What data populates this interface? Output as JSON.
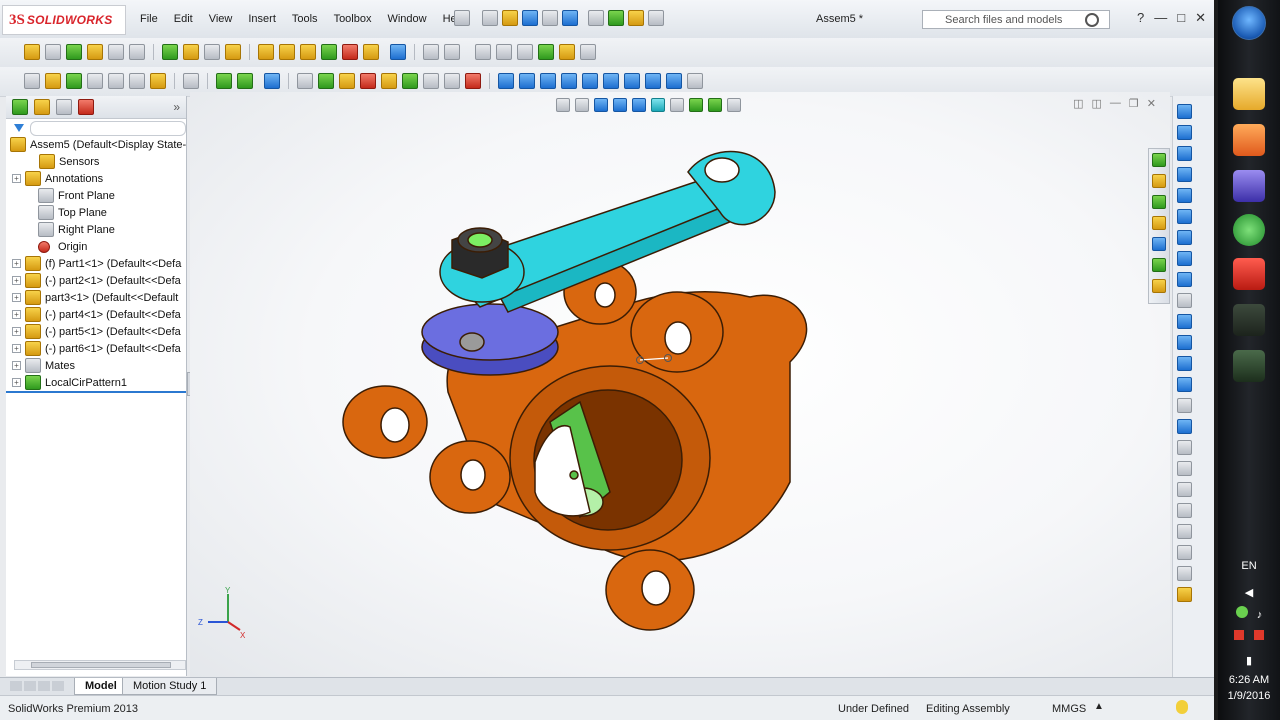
{
  "app": {
    "logo_prefix": "3S",
    "logo_text": "SOLIDWORKS",
    "document_title": "Assem5 *"
  },
  "menu": {
    "items": [
      "File",
      "Edit",
      "View",
      "Insert",
      "Tools",
      "Toolbox",
      "Window",
      "Help"
    ]
  },
  "search": {
    "placeholder": "Search files and models"
  },
  "feature_tree": {
    "root": "Assem5  (Default<Display State-",
    "items": [
      {
        "label": "Sensors",
        "expandable": false
      },
      {
        "label": "Annotations",
        "expandable": true
      },
      {
        "label": "Front Plane",
        "expandable": false
      },
      {
        "label": "Top Plane",
        "expandable": false
      },
      {
        "label": "Right Plane",
        "expandable": false
      },
      {
        "label": "Origin",
        "expandable": false
      },
      {
        "label": "(f) Part1<1> (Default<<Defa",
        "expandable": true
      },
      {
        "label": "(-) part2<1> (Default<<Defa",
        "expandable": true
      },
      {
        "label": "part3<1> (Default<<Default",
        "expandable": true
      },
      {
        "label": "(-) part4<1> (Default<<Defa",
        "expandable": true
      },
      {
        "label": "(-) part5<1> (Default<<Defa",
        "expandable": true
      },
      {
        "label": "(-) part6<1> (Default<<Defa",
        "expandable": true
      },
      {
        "label": "Mates",
        "expandable": true
      },
      {
        "label": "LocalCirPattern1",
        "expandable": true
      }
    ]
  },
  "triad": {
    "y_label": "Y",
    "x_label": "X",
    "z_label": "Z"
  },
  "bottom_tabs": {
    "model": "Model",
    "motion": "Motion Study 1"
  },
  "status_bar": {
    "product": "SolidWorks Premium 2013",
    "definition": "Under Defined",
    "mode": "Editing Assembly",
    "units": "MMGS"
  },
  "tray": {
    "language": "EN",
    "time": "6:26 AM",
    "date": "1/9/2016"
  },
  "colors": {
    "housing": "#d9670f",
    "lever": "#2fd3df",
    "washer": "#6b6ee0",
    "shaft": "#58c24a",
    "accent": "#d9242b"
  }
}
